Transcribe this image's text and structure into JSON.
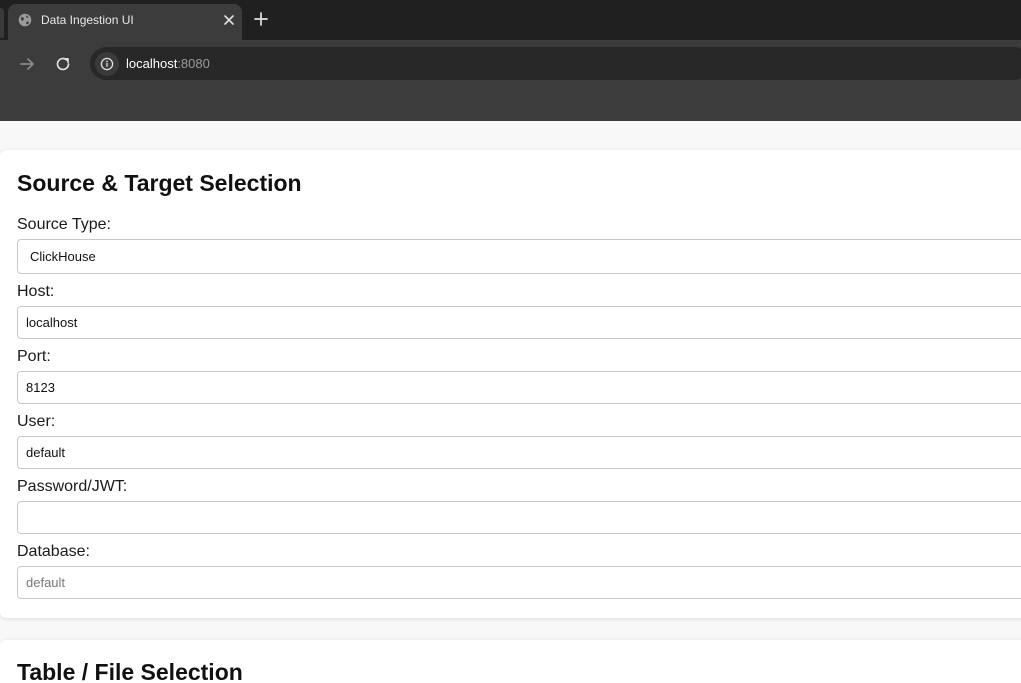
{
  "browser": {
    "tab_title": "Data Ingestion UI",
    "url_host": "localhost",
    "url_port": ":8080"
  },
  "source_target": {
    "title": "Source & Target Selection",
    "source_type_label": "Source Type:",
    "source_type_value": "ClickHouse",
    "host_label": "Host:",
    "host_value": "localhost",
    "port_label": "Port:",
    "port_value": "8123",
    "user_label": "User:",
    "user_value": "default",
    "password_label": "Password/JWT:",
    "password_value": "",
    "database_label": "Database:",
    "database_placeholder": "default"
  },
  "table_file": {
    "title": "Table / File Selection"
  }
}
